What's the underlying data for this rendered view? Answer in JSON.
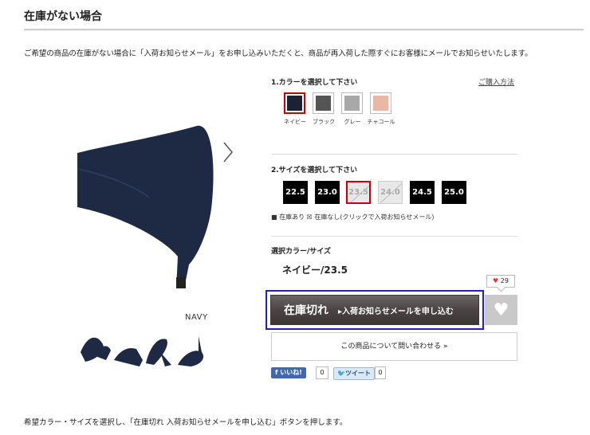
{
  "page": {
    "title": "在庫がない場合",
    "description": "ご希望の商品の在庫がない場合に「入荷お知らせメール」をお申し込みいただくと、商品が再入荷した際すぐにお客様にメールでお知らせいたします。",
    "footer_note": "希望カラー・サイズを選択し、「在庫切れ 入荷お知らせメールを申し込む」ボタンを押します。"
  },
  "product": {
    "color_caption": "NAVY",
    "next_icon": "chevron-right-icon"
  },
  "colors": {
    "label": "1.カラーを選択して下さい",
    "howto_link": "ご購入方法",
    "options": [
      {
        "name": "ネイビー",
        "swatch": "#1c2233",
        "selected": true
      },
      {
        "name": "ブラック",
        "swatch": "#555555",
        "selected": false
      },
      {
        "name": "グレー",
        "swatch": "#a8a8a8",
        "selected": false
      },
      {
        "name": "チャコール",
        "swatch": "#e9b7a6",
        "selected": false
      }
    ]
  },
  "sizes": {
    "label": "2.サイズを選択して下さい",
    "options": [
      {
        "value": "22.5",
        "state": "in_stock"
      },
      {
        "value": "23.0",
        "state": "in_stock"
      },
      {
        "value": "23.5",
        "state": "selected_out"
      },
      {
        "value": "24.0",
        "state": "out"
      },
      {
        "value": "24.5",
        "state": "in_stock"
      },
      {
        "value": "25.0",
        "state": "in_stock"
      }
    ],
    "legend": "■ 在庫あり  ☒ 在庫なし(クリックで入荷お知らせメール)"
  },
  "selection": {
    "label": "選択カラー/サイズ",
    "value": "ネイビー/23.5"
  },
  "actions": {
    "out_of_stock_main": "在庫切れ",
    "out_of_stock_sub": "▸入荷お知らせメールを申し込む",
    "favorite_count": "29",
    "inquiry": "この商品について問い合わせる »",
    "fb_like": "いいね!",
    "fb_count": "0",
    "tweet": "ツイート",
    "tweet_count": "0"
  },
  "colors_ui": {
    "highlight": "#2222bb",
    "selected_border": "#cc0000"
  }
}
